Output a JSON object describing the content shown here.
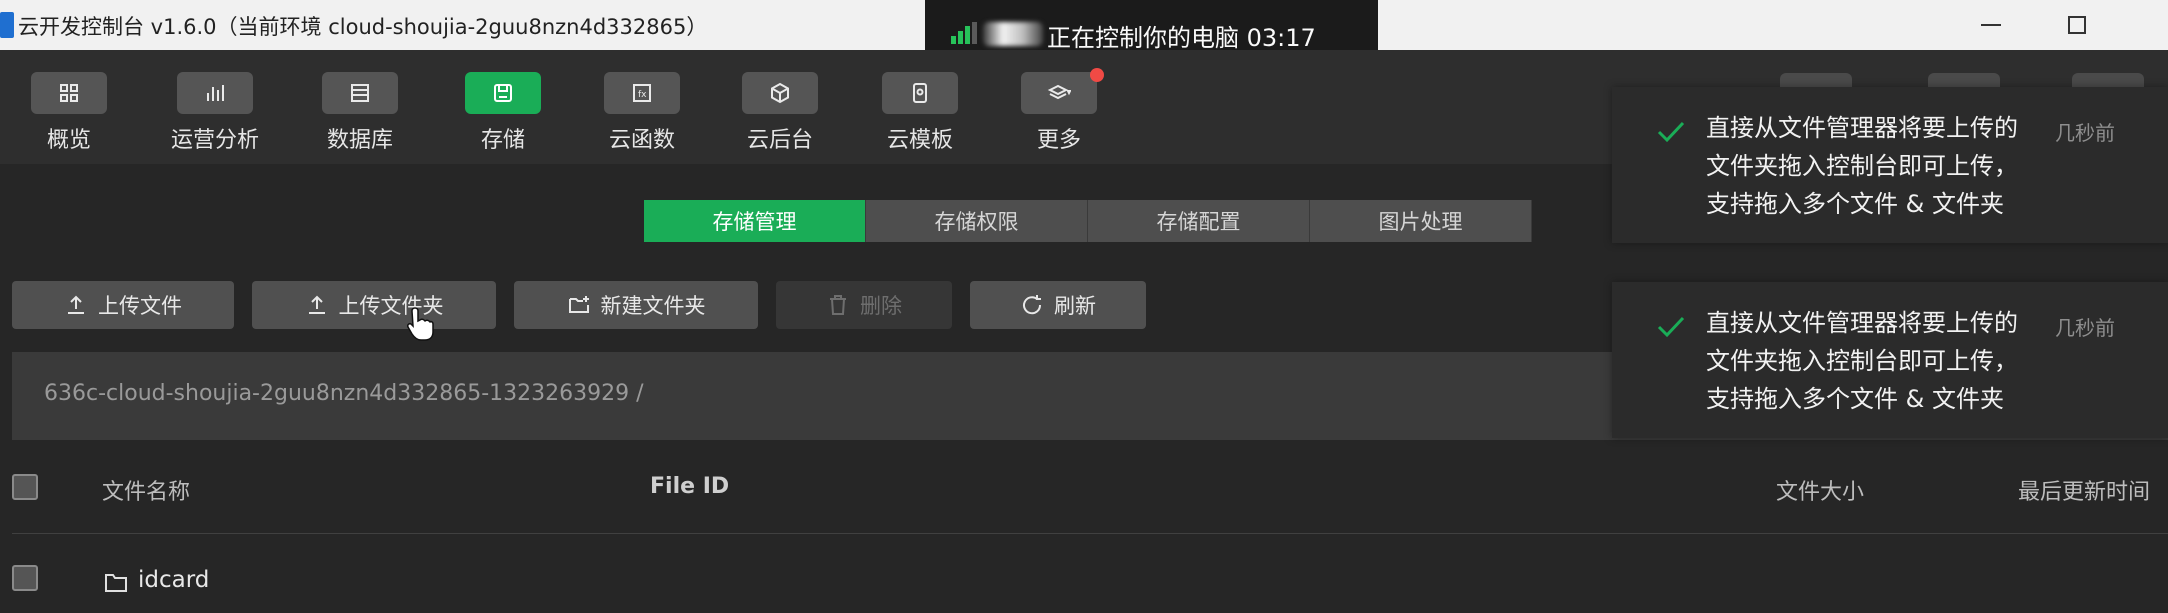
{
  "window": {
    "title": "云开发控制台 v1.6.0（当前环境 cloud-shoujia-2guu8nzn4d332865）"
  },
  "remote_banner": {
    "text": "正在控制你的电脑 03:17"
  },
  "toolbar": {
    "items": [
      {
        "label": "概览",
        "icon": "grid-icon"
      },
      {
        "label": "运营分析",
        "icon": "bar-chart-icon"
      },
      {
        "label": "数据库",
        "icon": "database-icon"
      },
      {
        "label": "存储",
        "icon": "storage-icon",
        "active": true
      },
      {
        "label": "云函数",
        "icon": "function-icon"
      },
      {
        "label": "云后台",
        "icon": "cube-icon"
      },
      {
        "label": "云模板",
        "icon": "template-icon"
      },
      {
        "label": "更多",
        "icon": "layers-icon"
      }
    ]
  },
  "tabs": [
    {
      "label": "存储管理",
      "active": true
    },
    {
      "label": "存储权限"
    },
    {
      "label": "存储配置"
    },
    {
      "label": "图片处理"
    }
  ],
  "actions": {
    "upload_file": "上传文件",
    "upload_folder": "上传文件夹",
    "new_folder": "新建文件夹",
    "delete": "删除",
    "refresh": "刷新"
  },
  "path": "636c-cloud-shoujia-2guu8nzn4d332865-1323263929 /",
  "table": {
    "headers": {
      "name": "文件名称",
      "file_id": "File ID",
      "size": "文件大小",
      "updated": "最后更新时间"
    },
    "rows": [
      {
        "name": "idcard",
        "type": "folder"
      }
    ]
  },
  "toasts": [
    {
      "message_line1": "直接从文件管理器将要上传的",
      "message_line2": "文件夹拖入控制台即可上传，",
      "message_line3": "支持拖入多个文件 & 文件夹",
      "time": "几秒前"
    },
    {
      "message_line1": "直接从文件管理器将要上传的",
      "message_line2": "文件夹拖入控制台即可上传，",
      "message_line3": "支持拖入多个文件 & 文件夹",
      "time": "几秒前"
    }
  ],
  "colors": {
    "accent": "#1aad57",
    "notification": "#f04a45",
    "background": "#262626"
  }
}
